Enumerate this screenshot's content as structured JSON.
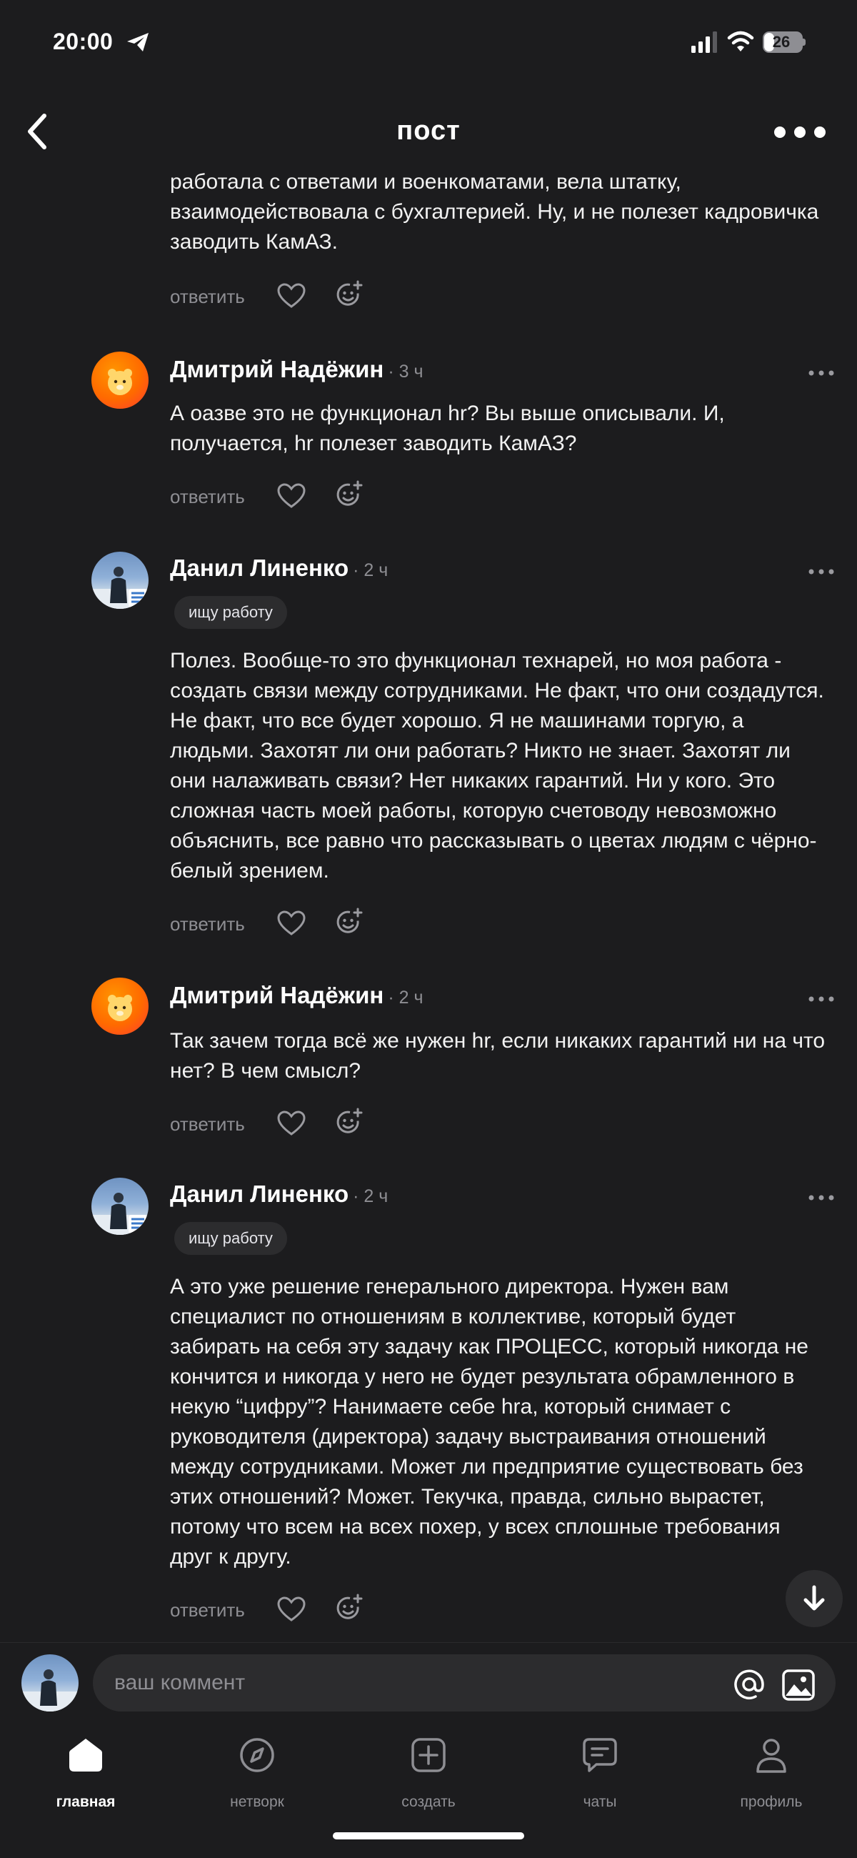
{
  "status_bar": {
    "time": "20:00",
    "battery": "26",
    "battery_level_percent": 26,
    "icons": [
      "telegram-icon",
      "signal-icon",
      "wifi-icon",
      "battery-icon"
    ]
  },
  "header": {
    "title": "пост",
    "icons": [
      "back-icon",
      "more-icon"
    ]
  },
  "thread": {
    "reply_label": "ответить",
    "partial_comment": {
      "text": "работала с ответами и военкоматами, вела штатку, взаимодействовала с бухгалтерией. Ну, и не полезет кадровичка заводить КамАЗ."
    },
    "comments": [
      {
        "author": "Дмитрий Надёжин",
        "time": "· 3 ч",
        "text": "А оазве это не функционал hr? Вы выше описывали. И, получается, hr полезет заводить КамАЗ?"
      },
      {
        "author": "Данил Линенко",
        "time": "· 2 ч",
        "badge": "ищу работу",
        "text": "Полез. Вообще-то это функционал технарей, но моя работа - создать связи между сотрудниками. Не факт, что они создадутся. Не факт, что все будет хорошо. Я не машинами торгую, а людьми. Захотят ли они работать? Никто не знает. Захотят ли они налаживать связи? Нет никаких гарантий. Ни у кого. Это сложная часть моей работы, которую счетоводу невозможно объяснить, все равно что рассказывать о цветах людям с чёрно-белый зрением."
      },
      {
        "author": "Дмитрий Надёжин",
        "time": "· 2 ч",
        "text": "Так зачем тогда всё же нужен hr, если никаких гарантий ни на что нет? В чем смысл?"
      },
      {
        "author": "Данил Линенко",
        "time": "· 2 ч",
        "badge": "ищу работу",
        "text": "А это уже решение генерального директора. Нужен вам специалист по отношениям в коллективе, который будет забирать на себя эту задачу как ПРОЦЕСС, который никогда не кончится и никогда у него не будет результата обрамленного в некую “цифру”? Нанимаете себе hra, который снимает с руководителя (директора) задачу выстраивания отношений между сотрудниками. Может ли предприятие существовать без этих отношений? Может. Текучка, правда, сильно вырастет, потому что всем на всех похер, у всех сплошные требования друг к другу."
      }
    ]
  },
  "comment_input": {
    "placeholder": "ваш коммент"
  },
  "tab_bar": {
    "tabs": [
      {
        "label": "главная",
        "icon": "home-icon",
        "active": true
      },
      {
        "label": "нетворк",
        "icon": "compass-icon",
        "active": false
      },
      {
        "label": "создать",
        "icon": "plus-square-icon",
        "active": false
      },
      {
        "label": "чаты",
        "icon": "chat-icon",
        "active": false
      },
      {
        "label": "профиль",
        "icon": "profile-icon",
        "active": false
      }
    ]
  },
  "colors": {
    "background": "#1c1c1e",
    "secondary_text": "#8e8e93",
    "avatar_accent": "#ff6a00"
  }
}
